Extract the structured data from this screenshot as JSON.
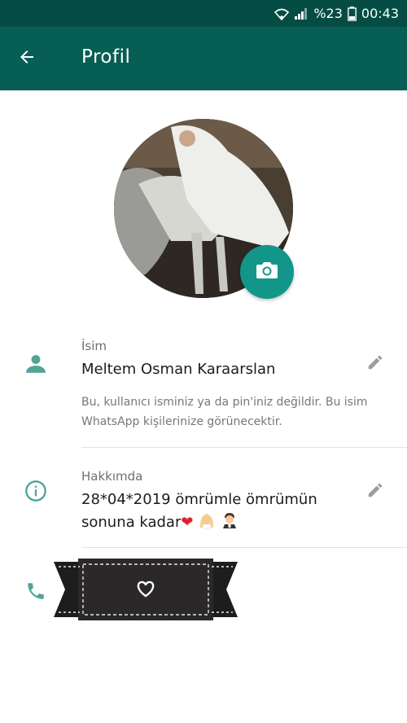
{
  "status_bar": {
    "battery_percent": "%23",
    "time": "00:43",
    "icons": [
      "wifi-icon",
      "signal-icon",
      "battery-icon"
    ]
  },
  "app_bar": {
    "title": "Profil",
    "back_icon": "arrow-left-icon"
  },
  "profile_photo": {
    "camera_icon": "camera-icon"
  },
  "name_section": {
    "label": "İsim",
    "value": "Meltem Osman Karaarslan",
    "hint": "Bu, kullanıcı isminiz ya da pin'iniz değildir. Bu isim WhatsApp kişilerinize görünecektir.",
    "icon": "person-icon",
    "edit_icon": "pencil-icon"
  },
  "about_section": {
    "label": "Hakkımda",
    "value_line1": "28*04*2019 ömrümle ömrümün",
    "value_line2": "sonuna kadar",
    "emojis": [
      "heart-emoji",
      "bride-emoji",
      "groom-emoji"
    ],
    "icon": "info-icon",
    "edit_icon": "pencil-icon"
  },
  "phone_section": {
    "icon": "phone-icon",
    "ribbon_icon": "heart-ribbon-icon"
  },
  "colors": {
    "status_bar": "#054d44",
    "app_bar": "#075e54",
    "accent": "#13968a",
    "icon_teal": "#52a398"
  }
}
